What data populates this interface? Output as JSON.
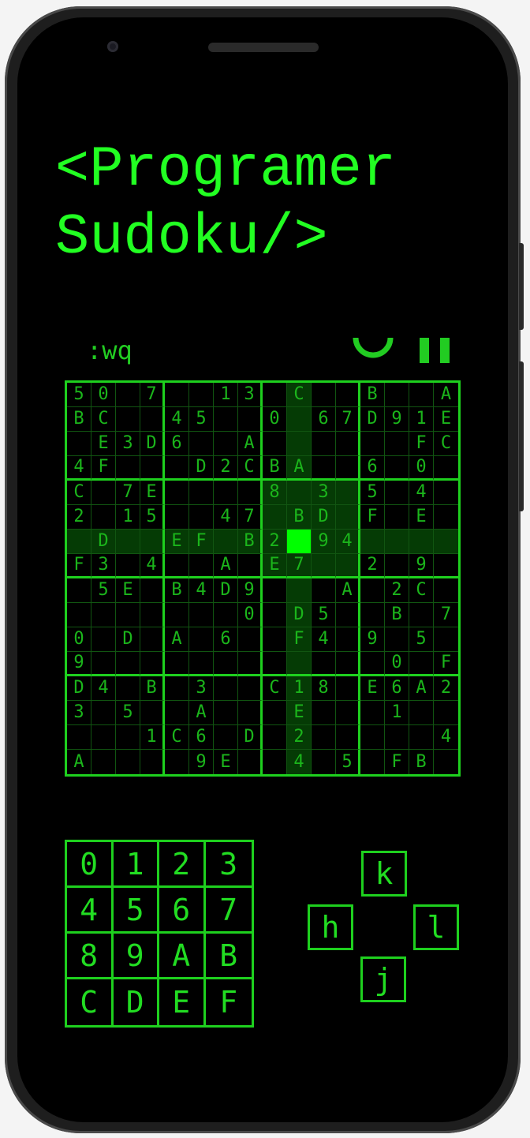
{
  "title": {
    "line1": "<Programer",
    "line2": "Sudoku/>"
  },
  "toolbar": {
    "command": ":wq",
    "undo_icon": "undo-arc-icon",
    "pause_icon": "pause-icon"
  },
  "colors": {
    "accent": "#22ff22",
    "cell_text": "#1bb51b",
    "highlight": "#053b05",
    "selected": "#00ff00",
    "background": "#000000"
  },
  "board": {
    "size": 16,
    "selected": {
      "row": 6,
      "col": 9
    },
    "rows": [
      [
        "5",
        "0",
        "",
        "7",
        "",
        "",
        "1",
        "3",
        "",
        "C",
        "",
        "",
        "B",
        "",
        "",
        "A"
      ],
      [
        "B",
        "C",
        "",
        "",
        "4",
        "5",
        "",
        "",
        "0",
        "",
        "6",
        "7",
        "D",
        "9",
        "1",
        "E"
      ],
      [
        "",
        "E",
        "3",
        "D",
        "6",
        "",
        "",
        "A",
        "",
        "",
        "",
        "",
        "",
        "",
        "F",
        "C"
      ],
      [
        "4",
        "F",
        "",
        "",
        "",
        "D",
        "2",
        "C",
        "B",
        "A",
        "",
        "",
        "6",
        "",
        "0",
        ""
      ],
      [
        "C",
        "",
        "7",
        "E",
        "",
        "",
        "",
        "",
        "8",
        "",
        "3",
        "",
        "5",
        "",
        "4",
        ""
      ],
      [
        "2",
        "",
        "1",
        "5",
        "",
        "",
        "4",
        "7",
        "",
        "B",
        "D",
        "",
        "F",
        "",
        "E",
        ""
      ],
      [
        "",
        "D",
        "",
        "",
        "E",
        "F",
        "",
        "B",
        "2",
        "",
        "9",
        "4",
        "",
        "",
        "",
        ""
      ],
      [
        "F",
        "3",
        "",
        "4",
        "",
        "",
        "A",
        "",
        "E",
        "7",
        "",
        "",
        "2",
        "",
        "9",
        ""
      ],
      [
        "",
        "5",
        "E",
        "",
        "B",
        "4",
        "D",
        "9",
        "",
        "",
        "",
        "A",
        "",
        "2",
        "C",
        ""
      ],
      [
        "",
        "",
        "",
        "",
        "",
        "",
        "",
        "0",
        "",
        "D",
        "5",
        "",
        "",
        "B",
        "",
        "7"
      ],
      [
        "0",
        "",
        "D",
        "",
        "A",
        "",
        "6",
        "",
        "",
        "F",
        "4",
        "",
        "9",
        "",
        "5",
        ""
      ],
      [
        "9",
        "",
        "",
        "",
        "",
        "",
        "",
        "",
        "",
        "",
        "",
        "",
        "",
        "0",
        "",
        "F"
      ],
      [
        "D",
        "4",
        "",
        "B",
        "",
        "3",
        "",
        "",
        "C",
        "1",
        "8",
        "",
        "E",
        "6",
        "A",
        "2"
      ],
      [
        "3",
        "",
        "5",
        "",
        "",
        "A",
        "",
        "",
        "",
        "E",
        "",
        "",
        "",
        "1",
        "",
        ""
      ],
      [
        "",
        "",
        "",
        "1",
        "C",
        "6",
        "",
        "D",
        "",
        "2",
        "",
        "",
        "",
        "",
        "",
        "4"
      ],
      [
        "A",
        "",
        "",
        "",
        "",
        "9",
        "E",
        "",
        "",
        "4",
        "",
        "5",
        "",
        "F",
        "B",
        ""
      ]
    ]
  },
  "numpad": [
    "0",
    "1",
    "2",
    "3",
    "4",
    "5",
    "6",
    "7",
    "8",
    "9",
    "A",
    "B",
    "C",
    "D",
    "E",
    "F"
  ],
  "nav": {
    "up": "k",
    "left": "h",
    "right": "l",
    "down": "j"
  }
}
